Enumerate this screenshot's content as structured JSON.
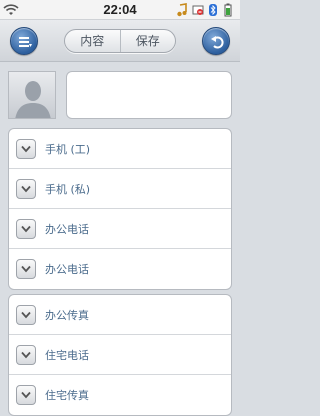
{
  "status_bar": {
    "time": "22:04",
    "left_icon": "wifi-icon",
    "right_icons": [
      "music-note-icon",
      "mail-blocked-icon",
      "bluetooth-icon",
      "battery-icon"
    ]
  },
  "toolbar": {
    "menu_icon": "list-menu-icon",
    "tabs": [
      {
        "label": "内容"
      },
      {
        "label": "保存"
      }
    ],
    "back_icon": "undo-arrow-icon",
    "accent_color": "#2d5f9e"
  },
  "contact": {
    "avatar_icon": "person-silhouette-icon",
    "name_value": ""
  },
  "fields": {
    "group1": [
      {
        "label": "手机 (工)",
        "icon": "chevron-down-icon"
      },
      {
        "label": "手机 (私)",
        "icon": "chevron-down-icon"
      },
      {
        "label": "办公电话",
        "icon": "chevron-down-icon"
      },
      {
        "label": "办公电话",
        "icon": "chevron-down-icon"
      }
    ],
    "group2": [
      {
        "label": "办公传真",
        "icon": "chevron-down-icon"
      },
      {
        "label": "住宅电话",
        "icon": "chevron-down-icon"
      },
      {
        "label": "住宅传真",
        "icon": "chevron-down-icon"
      }
    ]
  }
}
